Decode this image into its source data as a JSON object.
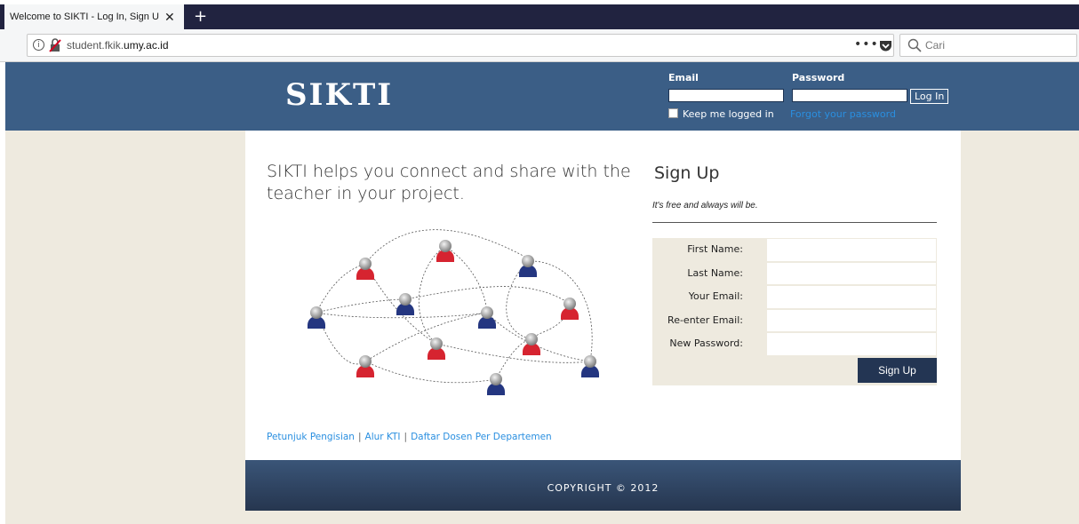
{
  "browser": {
    "tab_title": "Welcome to SIKTI - Log In, Sign Up",
    "tab_close": "✕",
    "new_tab": "+",
    "url_prefix": "student.fkik.",
    "url_domain": "umy.ac.id",
    "more": "•••",
    "search_placeholder": "Cari"
  },
  "header": {
    "logo": "SIKTI",
    "email_label": "Email",
    "password_label": "Password",
    "login_button": "Log In",
    "keep_logged_in": "Keep me logged in",
    "forgot_password": "Forgot your password"
  },
  "main": {
    "tagline": "SIKTI helps you connect and share with the teacher in your project."
  },
  "signup": {
    "title": "Sign Up",
    "subtitle": "It's free and always will be.",
    "fields": [
      "First Name:",
      "Last Name:",
      "Your Email:",
      "Re-enter Email:",
      "New Password:"
    ],
    "button": "Sign Up"
  },
  "links": {
    "item1": "Petunjuk Pengisian",
    "item2": "Alur KTI",
    "item3": "Daftar Dosen Per Departemen",
    "separator": "|"
  },
  "footer": {
    "copyright": "COPYRIGHT © 2012"
  },
  "colors": {
    "header_bg": "#3b5e86",
    "page_bg": "#eeeadf",
    "link": "#2a8fe0",
    "button": "#233553",
    "person_red": "#d62430",
    "person_blue": "#243680"
  }
}
